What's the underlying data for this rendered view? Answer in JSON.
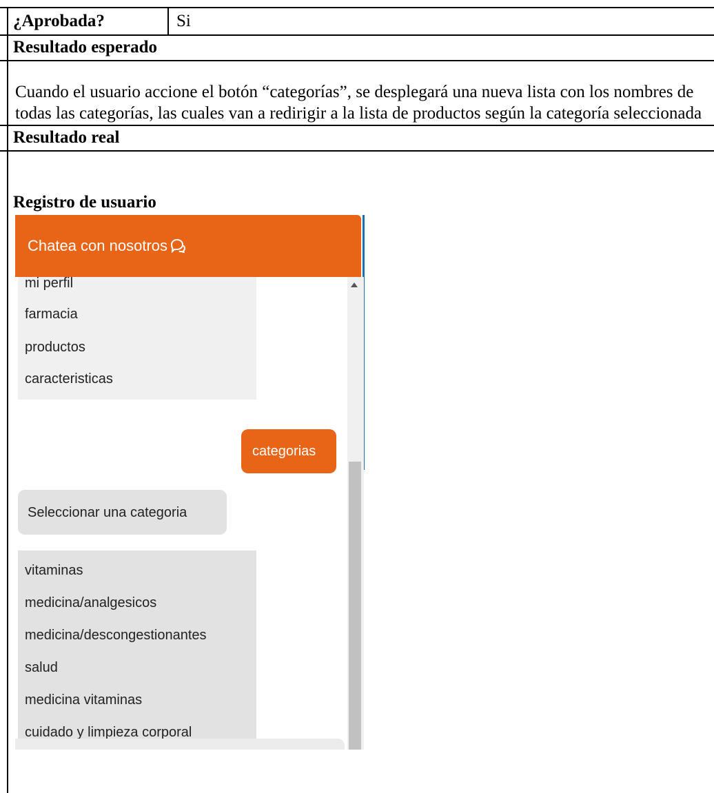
{
  "table": {
    "approved_label": "¿Aprobada?",
    "approved_value": "Si",
    "expected_label": "Resultado esperado",
    "expected_text": "Cuando el usuario accione el botón “categorías”, se desplegará una nueva lista con los nombres de todas las categorías, las cuales van a redirigir a la lista de productos según la categoría seleccionada",
    "real_label": "Resultado real",
    "section_heading": "Registro de usuario"
  },
  "chat": {
    "header_title": "Chatea con nosotros",
    "header_icon": "chat-bubbles-icon",
    "accent_color": "#e86417",
    "menu_items": [
      "mi perfil",
      "farmacia",
      "productos",
      "caracteristicas"
    ],
    "user_message": "categorias",
    "bot_message": "Seleccionar una categoria",
    "categories": [
      "vitaminas",
      "medicina/analgesicos",
      "medicina/descongestionantes",
      "salud",
      "medicina vitaminas",
      "cuidado y limpieza corporal"
    ]
  }
}
